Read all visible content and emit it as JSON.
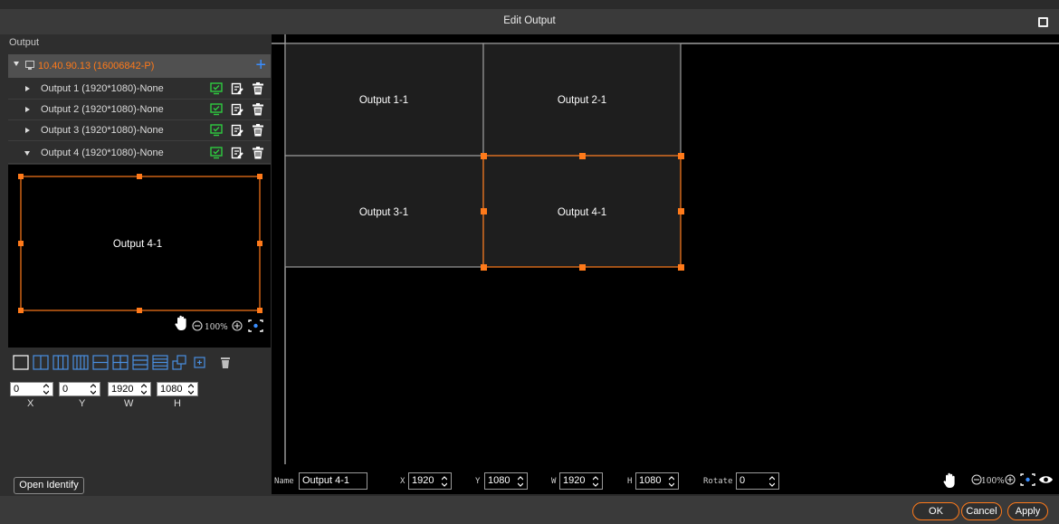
{
  "window": {
    "title": "Edit Output"
  },
  "left_panel": {
    "section_label": "Output",
    "device": {
      "label": "10.40.90.13  (16006842-P)"
    },
    "outputs": [
      {
        "label": "Output 1 (1920*1080)-None",
        "expanded": false
      },
      {
        "label": "Output 2 (1920*1080)-None",
        "expanded": false
      },
      {
        "label": "Output 3 (1920*1080)-None",
        "expanded": false
      },
      {
        "label": "Output 4 (1920*1080)-None",
        "expanded": true
      }
    ],
    "preview": {
      "label": "Output 4-1",
      "zoom": "100%"
    },
    "fields": {
      "x": "0",
      "y": "0",
      "w": "1920",
      "h": "1080"
    },
    "field_captions": {
      "x": "X",
      "y": "Y",
      "w": "W",
      "h": "H"
    },
    "open_identify_label": "Open Identify"
  },
  "canvas": {
    "cells": [
      {
        "label": "Output 1-1"
      },
      {
        "label": "Output 2-1"
      },
      {
        "label": "Output 3-1"
      },
      {
        "label": "Output 4-1"
      }
    ],
    "zoom": "100%"
  },
  "properties": {
    "name_label": "Name",
    "name_value": "Output 4-1",
    "x_label": "X",
    "x_value": "1920",
    "y_label": "Y",
    "y_value": "1080",
    "w_label": "W",
    "w_value": "1920",
    "h_label": "H",
    "h_value": "1080",
    "rotate_label": "Rotate",
    "rotate_value": "0"
  },
  "footer": {
    "ok": "OK",
    "cancel": "Cancel",
    "apply": "Apply"
  },
  "colors": {
    "accent": "#ff7a1a",
    "add": "#3a8eff",
    "icon_green": "#2ecc40",
    "layout_blue": "#4a90e2"
  }
}
